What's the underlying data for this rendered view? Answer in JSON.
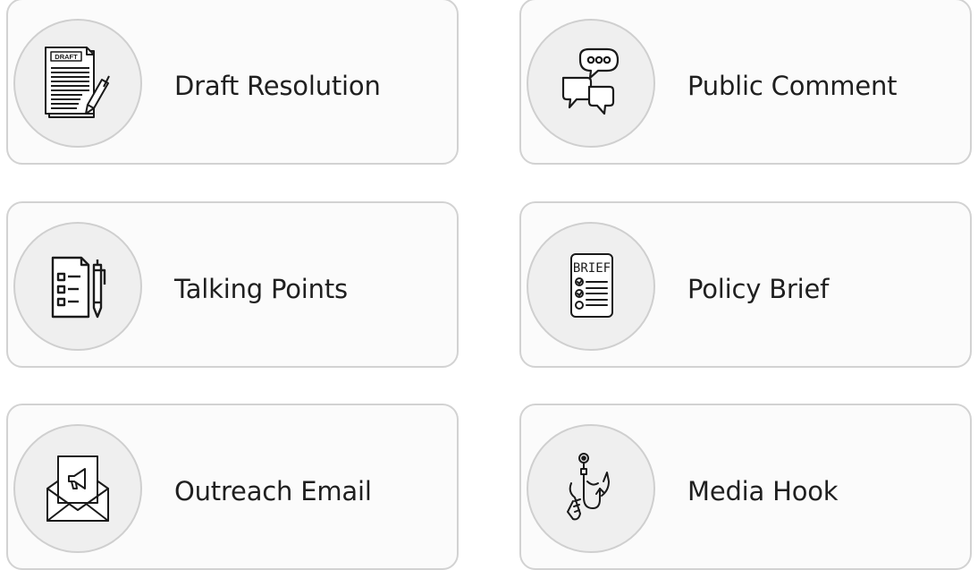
{
  "cards": [
    {
      "label": "Draft Resolution",
      "icon": "draft-document-icon",
      "icon_text": "DRAFT"
    },
    {
      "label": "Public Comment",
      "icon": "speech-bubbles-icon"
    },
    {
      "label": "Talking Points",
      "icon": "checklist-pen-icon"
    },
    {
      "label": "Policy Brief",
      "icon": "policy-brief-icon",
      "icon_text": "BRIEF"
    },
    {
      "label": "Outreach Email",
      "icon": "megaphone-envelope-icon"
    },
    {
      "label": "Media Hook",
      "icon": "fishing-hook-icon"
    }
  ],
  "colors": {
    "card_border": "#d2d2d2",
    "card_bg": "#fbfbfb",
    "circle_bg": "#efefef",
    "text": "#1f1f1f"
  }
}
